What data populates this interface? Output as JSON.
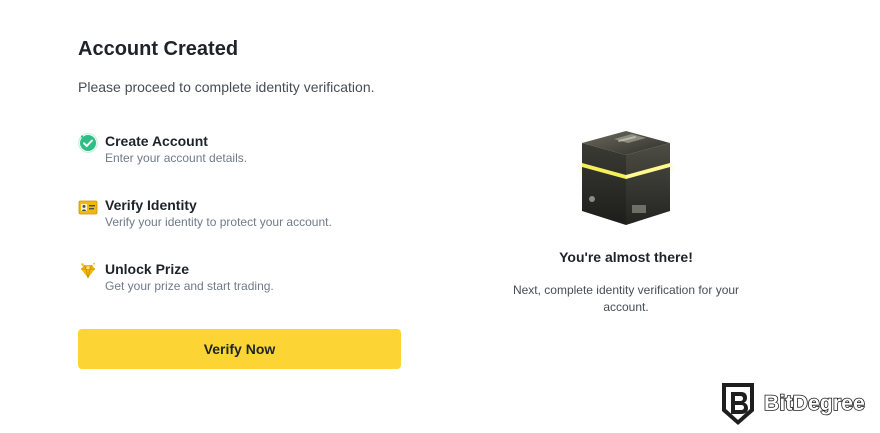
{
  "header": {
    "title": "Account Created",
    "subtitle": "Please proceed to complete identity verification."
  },
  "steps": [
    {
      "icon": "check-circle-icon",
      "title": "Create Account",
      "description": "Enter your account details."
    },
    {
      "icon": "id-card-icon",
      "title": "Verify Identity",
      "description": "Verify your identity to protect your account."
    },
    {
      "icon": "gem-prize-icon",
      "title": "Unlock Prize",
      "description": "Get your prize and start trading."
    }
  ],
  "actions": {
    "verify_label": "Verify Now"
  },
  "promo": {
    "image": "mystery-box-icon",
    "heading": "You're almost there!",
    "text": "Next, complete identity verification for your account."
  },
  "watermark": {
    "text": "BitDegree",
    "icon": "bitdegree-shield-icon"
  },
  "colors": {
    "accent": "#fcd535",
    "success": "#2ebd85",
    "text_primary": "#1e2329",
    "text_secondary": "#707a8a"
  }
}
